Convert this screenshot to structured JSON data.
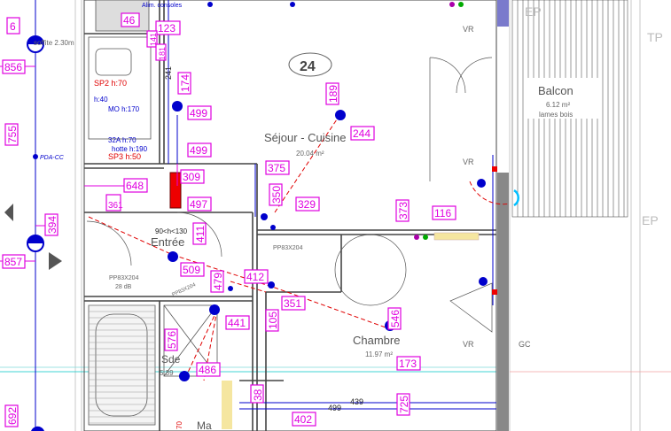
{
  "plan": {
    "unit_number": "24",
    "rooms": {
      "sejour": {
        "name": "Séjour - Cuisine",
        "area": "20.04 m²"
      },
      "balcon": {
        "name": "Balcon",
        "area": "6.12 m²",
        "note": "lames bois"
      },
      "entree": {
        "name": "Entrée"
      },
      "chambre": {
        "name": "Chambre",
        "area": "11.97 m²"
      },
      "sdb": {
        "name": "Sde",
        "area": "5.39"
      },
      "bottom_room": {
        "name": "Ma"
      }
    },
    "codes": {
      "vr_top": "VR",
      "vr_right": "VR",
      "vr_bottom": "VR",
      "gc": "GC",
      "ep_top": "EP",
      "tp": "TP",
      "ep_right": "EP"
    },
    "partitions": [
      "PP83X204",
      "PP83X204",
      "PP83X204"
    ],
    "partition_note": "28 dB",
    "annotations": {
      "sp2": "SP2 h:70",
      "h40": "h:40",
      "mo": "MO h:170",
      "t32a": "32A h:70",
      "hotte": "hotte h:190",
      "sp3": "SP3 h:50",
      "dim_90_130": "90<h<130",
      "pdacc": "PDA-CC",
      "soffite": "soffite 2.30m",
      "alim": "Alim. consoles",
      "dim_439": "439",
      "dim_499": "499"
    },
    "tags": [
      "46",
      "123",
      "141",
      "181",
      "241",
      "174",
      "499",
      "499",
      "856",
      "755",
      "648",
      "309",
      "497",
      "375",
      "189",
      "244",
      "350",
      "329",
      "361",
      "394",
      "857",
      "411",
      "509",
      "412",
      "479",
      "351",
      "441",
      "373",
      "116",
      "546",
      "173",
      "105",
      "576",
      "486",
      "38",
      "402",
      "725",
      "692",
      "6",
      "70"
    ]
  }
}
